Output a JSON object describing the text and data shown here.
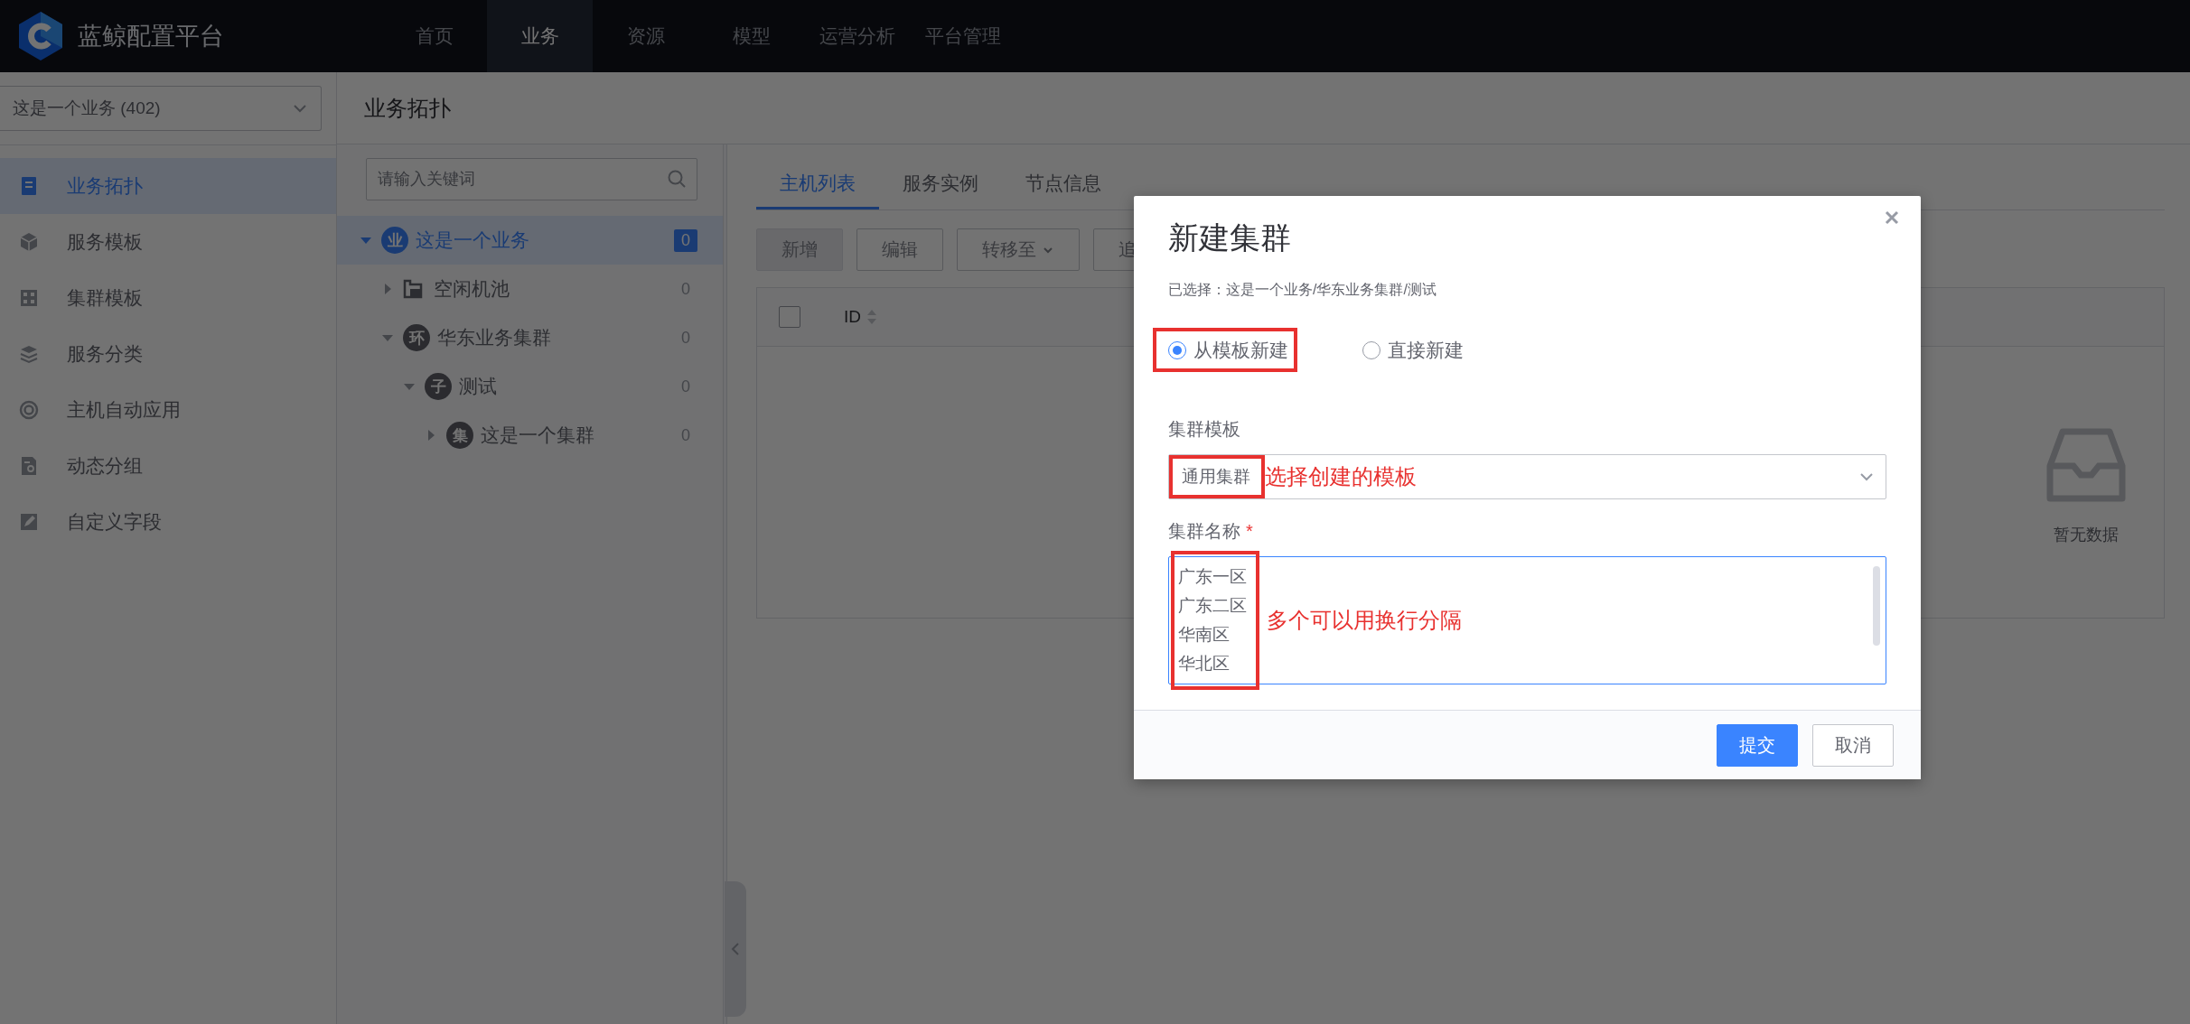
{
  "header": {
    "brand": "蓝鲸配置平台",
    "nav": [
      {
        "label": "首页",
        "selected": false
      },
      {
        "label": "业务",
        "selected": true
      },
      {
        "label": "资源",
        "selected": false
      },
      {
        "label": "模型",
        "selected": false
      },
      {
        "label": "运营分析",
        "selected": false
      },
      {
        "label": "平台管理",
        "selected": false
      }
    ]
  },
  "sidebar": {
    "business": "这是一个业务 (402)",
    "items": [
      {
        "label": "业务拓扑",
        "selected": true
      },
      {
        "label": "服务模板",
        "selected": false
      },
      {
        "label": "集群模板",
        "selected": false
      },
      {
        "label": "服务分类",
        "selected": false
      },
      {
        "label": "主机自动应用",
        "selected": false
      },
      {
        "label": "动态分组",
        "selected": false
      },
      {
        "label": "自定义字段",
        "selected": false
      }
    ]
  },
  "page_title": "业务拓扑",
  "tree": {
    "placeholder": "请输入关键词",
    "nodes": [
      {
        "label": "这是一个业务",
        "badge": "业",
        "count": "0",
        "expanded": true,
        "selected": true,
        "children": [
          {
            "label": "空闲机池",
            "count": "0",
            "expanded": false,
            "selected": false
          },
          {
            "label": "华东业务集群",
            "badge": "环",
            "count": "0",
            "expanded": true,
            "selected": false,
            "children": [
              {
                "label": "测试",
                "badge": "子",
                "count": "0",
                "expanded": true,
                "selected": false,
                "children": [
                  {
                    "label": "这是一个集群",
                    "badge": "集",
                    "count": "0",
                    "expanded": false,
                    "selected": false
                  }
                ]
              }
            ]
          }
        ]
      }
    ]
  },
  "tabs": [
    {
      "label": "主机列表",
      "selected": true
    },
    {
      "label": "服务实例",
      "selected": false
    },
    {
      "label": "节点信息",
      "selected": false
    }
  ],
  "toolbar": [
    {
      "label": "新增",
      "kind": "primary",
      "disabled": true,
      "dropdown": false
    },
    {
      "label": "编辑",
      "kind": "default",
      "disabled": true,
      "dropdown": false
    },
    {
      "label": "转移至",
      "kind": "default",
      "disabled": true,
      "dropdown": true
    },
    {
      "label": "追",
      "kind": "default",
      "disabled": true,
      "dropdown": false
    }
  ],
  "table": {
    "select_all": {
      "checked": false
    },
    "columns": [
      {
        "label": "ID",
        "sortable": true
      }
    ],
    "empty_text": "暂无数据"
  },
  "dialog": {
    "title": "新建集群",
    "subtitle": "已选择：这是一个业务/华东业务集群/测试",
    "modes": [
      {
        "label": "从模板新建",
        "selected": true,
        "annotated": true
      },
      {
        "label": "直接新建",
        "selected": false,
        "annotated": false
      }
    ],
    "template_field": {
      "label": "集群模板",
      "value": "通用集群",
      "annotated": true,
      "note": "选择创建的模板"
    },
    "name_field": {
      "label": "集群名称",
      "required_mark": "*",
      "lines": [
        "广东一区",
        "广东二区",
        "华南区",
        "华北区"
      ],
      "annotated": true,
      "note": "多个可以用换行分隔"
    },
    "buttons": [
      {
        "label": "提交",
        "kind": "primary"
      },
      {
        "label": "取消",
        "kind": "default"
      }
    ]
  }
}
